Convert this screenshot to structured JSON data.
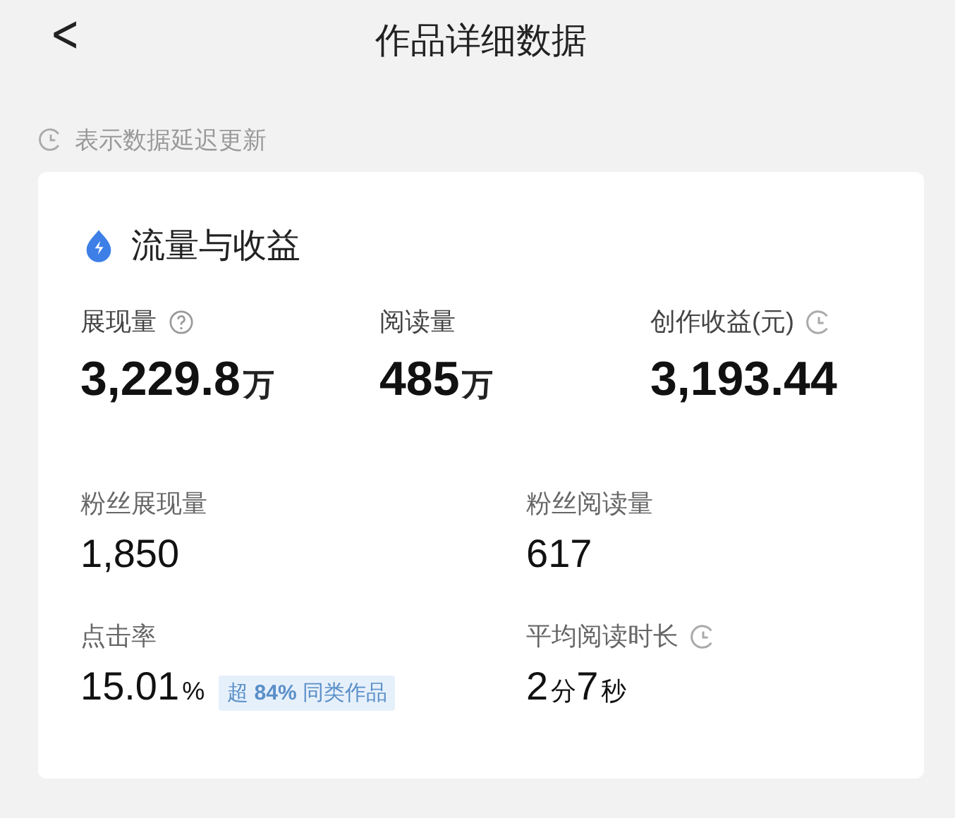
{
  "header": {
    "back": "<",
    "title": "作品详细数据"
  },
  "notice": {
    "text": "表示数据延迟更新"
  },
  "card": {
    "title": "流量与收益",
    "top_metrics": [
      {
        "kind": "help",
        "label": "展现量",
        "value": "3,229.8",
        "unit": "万"
      },
      {
        "kind": "plain",
        "label": "阅读量",
        "value": "485",
        "unit": "万"
      },
      {
        "kind": "delayed",
        "label": "创作收益(元)",
        "value": "3,193.44"
      }
    ],
    "metrics": [
      {
        "kind": "plain",
        "label": "粉丝展现量",
        "value": "1,850"
      },
      {
        "kind": "plain",
        "label": "粉丝阅读量",
        "value": "617"
      },
      {
        "kind": "plain",
        "label": "点击率",
        "value": "15.01",
        "unit": "%",
        "badge": "超 **84%** 同类作品"
      },
      {
        "kind": "delayed",
        "label": "平均阅读时长",
        "parts": [
          {
            "value": "2",
            "unit": "分"
          },
          {
            "value": "7",
            "unit": "秒"
          }
        ]
      }
    ]
  }
}
